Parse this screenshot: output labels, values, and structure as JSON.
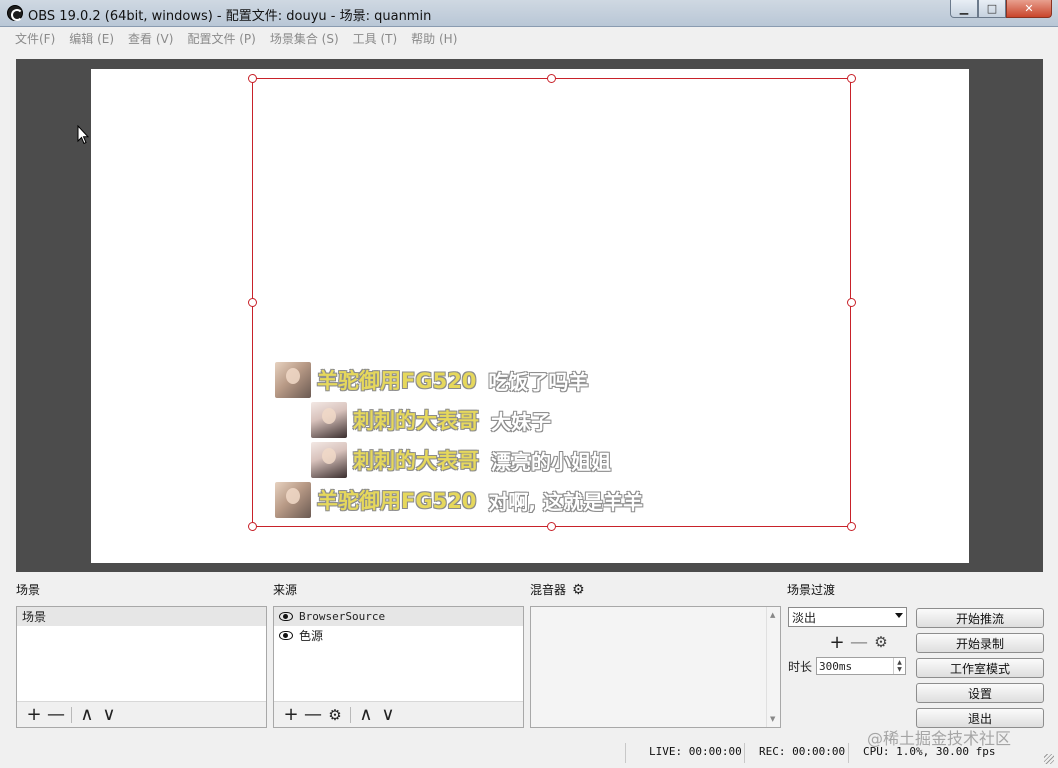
{
  "window": {
    "title": "OBS 19.0.2 (64bit, windows) - 配置文件: douyu - 场景: quanmin",
    "minimize": "▁",
    "maximize": "□",
    "close": "✕"
  },
  "menu": {
    "items": [
      "文件(F)",
      "编辑 (E)",
      "查看 (V)",
      "配置文件 (P)",
      "场景集合 (S)",
      "工具 (T)",
      "帮助 (H)"
    ]
  },
  "preview": {
    "chat": [
      {
        "avatar": "avatar-boy",
        "name": "羊驼御用FG520",
        "message": "吃饭了吗羊"
      },
      {
        "avatar": "avatar-girl",
        "name": "刺刺的大表哥",
        "message": "大妹子"
      },
      {
        "avatar": "avatar-girl",
        "name": "刺刺的大表哥",
        "message": "漂亮的小姐姐"
      },
      {
        "avatar": "avatar-boy",
        "name": "羊驼御用FG520",
        "message": "对啊, 这就是羊羊"
      }
    ]
  },
  "docks": {
    "scenes": {
      "label": "场景",
      "items": [
        "场景"
      ]
    },
    "sources": {
      "label": "来源",
      "items": [
        "BrowserSource",
        "色源"
      ]
    },
    "mixer": {
      "label": "混音器"
    },
    "transitions": {
      "label": "场景过渡",
      "selected": "淡出",
      "duration_label": "时长",
      "duration_value": "300ms"
    }
  },
  "controls": {
    "start_streaming": "开始推流",
    "start_recording": "开始录制",
    "studio_mode": "工作室模式",
    "settings": "设置",
    "exit": "退出"
  },
  "status": {
    "live": "LIVE: 00:00:00",
    "rec": "REC: 00:00:00",
    "cpu": "CPU: 1.0%, 30.00 fps"
  },
  "watermark": "@稀土掘金技术社区",
  "icons": {
    "plus": "+",
    "minus": "—",
    "up": "∧",
    "down": "∨",
    "gear": "⚙"
  }
}
